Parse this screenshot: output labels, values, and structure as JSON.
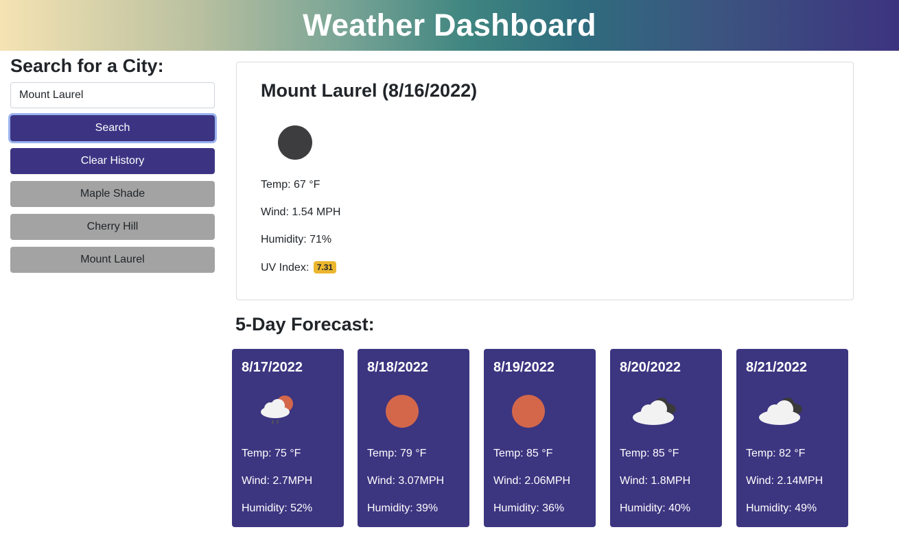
{
  "header": {
    "title": "Weather Dashboard"
  },
  "search": {
    "heading": "Search for a City:",
    "input_value": "Mount Laurel",
    "search_label": "Search",
    "clear_label": "Clear History",
    "history": [
      "Maple Shade",
      "Cherry Hill",
      "Mount Laurel"
    ]
  },
  "current": {
    "title": "Mount Laurel (8/16/2022)",
    "icon": "moon-icon",
    "temp": "Temp: 67 °F",
    "wind": "Wind: 1.54 MPH",
    "humidity": "Humidity: 71%",
    "uv_label": "UV Index:",
    "uv_value": "7.31",
    "uv_color": "#ebb72f"
  },
  "forecast": {
    "heading": "5-Day Forecast:",
    "days": [
      {
        "date": "8/17/2022",
        "icon": "rain-sun-cloud-icon",
        "temp": "Temp: 75 °F",
        "wind": "Wind: 2.7MPH",
        "humidity": "Humidity: 52%"
      },
      {
        "date": "8/18/2022",
        "icon": "sun-icon",
        "temp": "Temp: 79 °F",
        "wind": "Wind: 3.07MPH",
        "humidity": "Humidity: 39%"
      },
      {
        "date": "8/19/2022",
        "icon": "sun-icon",
        "temp": "Temp: 85 °F",
        "wind": "Wind: 2.06MPH",
        "humidity": "Humidity: 36%"
      },
      {
        "date": "8/20/2022",
        "icon": "broken-clouds-icon",
        "temp": "Temp: 85 °F",
        "wind": "Wind: 1.8MPH",
        "humidity": "Humidity: 40%"
      },
      {
        "date": "8/21/2022",
        "icon": "broken-clouds-icon",
        "temp": "Temp: 82 °F",
        "wind": "Wind: 2.14MPH",
        "humidity": "Humidity: 49%"
      }
    ]
  },
  "colors": {
    "primary": "#3c3483",
    "card": "#3c3580",
    "history_button": "#a3a3a3",
    "sun": "#d4674a"
  }
}
